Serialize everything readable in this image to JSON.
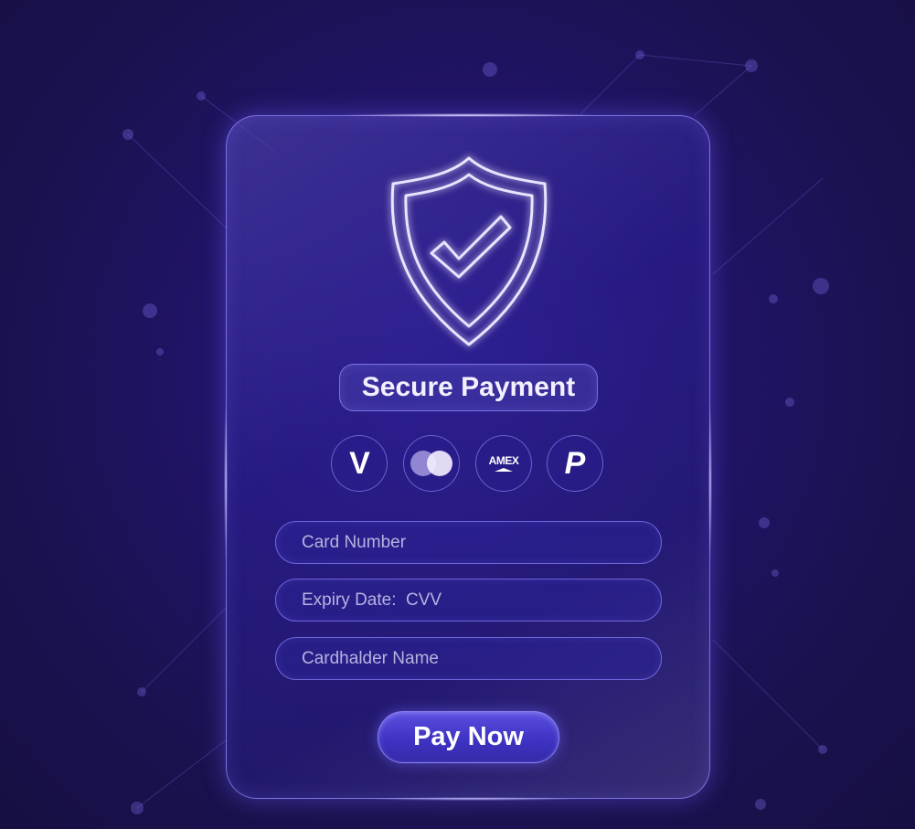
{
  "theme": {
    "accent": "#6c5cff",
    "background": "#1e1460",
    "glow": "#c8c0ff"
  },
  "title": "Secure Payment",
  "shield_icon": "shield-check-icon",
  "payment_methods": [
    {
      "icon": "visa-icon",
      "label": "V"
    },
    {
      "icon": "mastercard-icon",
      "label": ""
    },
    {
      "icon": "amex-icon",
      "label": "AMEX"
    },
    {
      "icon": "paypal-icon",
      "label": "P"
    }
  ],
  "fields": {
    "card_number": {
      "placeholder": "Card Number"
    },
    "expiry_cvv": {
      "placeholder": "Expiry Date:  CVV"
    },
    "cardholder_name": {
      "placeholder": "Cardhalder Name"
    }
  },
  "pay_button": {
    "label": "Pay Now"
  }
}
